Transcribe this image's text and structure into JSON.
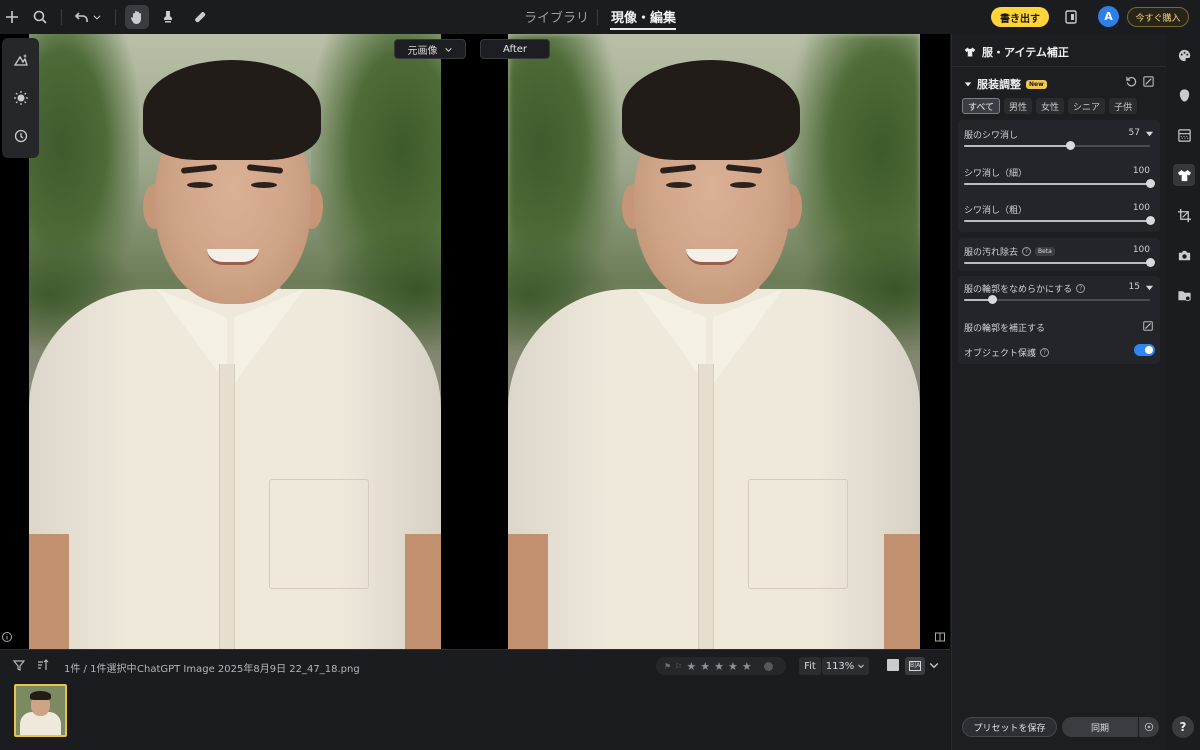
{
  "topbar": {
    "tabs": [
      {
        "label": "ライブラリ",
        "active": false
      },
      {
        "label": "現像・編集",
        "active": true
      }
    ],
    "export_label": "書き出す",
    "avatar_initial": "A",
    "buy_label": "今すぐ購入",
    "icons": [
      "plus-icon",
      "search-icon",
      "undo-icon",
      "chevron-down-icon",
      "hand-icon",
      "stamp-icon",
      "bandage-icon",
      "compare-icon"
    ],
    "accent_color": "#ffd43b"
  },
  "canvas": {
    "view_select": "元画像",
    "after_label": "After"
  },
  "filmstrip": {
    "selection_text": "1件 / 1件選択中",
    "filename": "ChatGPT Image 2025年8月9日 22_47_18.png",
    "rating": 0,
    "fit_label": "Fit",
    "zoom": "113%"
  },
  "panel": {
    "title": "服・アイテム補正",
    "section_title": "服装調整",
    "new_badge": "New",
    "categories": [
      {
        "label": "すべて",
        "active": true
      },
      {
        "label": "男性",
        "active": false
      },
      {
        "label": "女性",
        "active": false
      },
      {
        "label": "シニア",
        "active": false
      },
      {
        "label": "子供",
        "active": false
      }
    ],
    "sliders": {
      "wrinkle": {
        "label": "服のシワ消し",
        "value": 57,
        "max": 100
      },
      "wrinkle_fine": {
        "label": "シワ消し（細）",
        "value": 100,
        "max": 100
      },
      "wrinkle_coarse": {
        "label": "シワ消し（粗）",
        "value": 100,
        "max": 100
      },
      "stain": {
        "label": "服の汚れ除去",
        "beta": "Beta",
        "value": 100,
        "max": 100
      },
      "smooth_outline": {
        "label": "服の輪郭をなめらかにする",
        "value": 15,
        "max": 100
      }
    },
    "correct_outline_label": "服の輪郭を補正する",
    "object_protect_label": "オブジェクト保護",
    "object_protect_on": true,
    "preset_button": "プリセットを保存",
    "sync_button": "同期"
  },
  "rail": {
    "icons": [
      "palette-icon",
      "face-icon",
      "gradient-icon",
      "shirt-icon",
      "crop-icon",
      "camera-icon",
      "folder-icon"
    ],
    "active": "shirt-icon",
    "help_label": "?"
  }
}
